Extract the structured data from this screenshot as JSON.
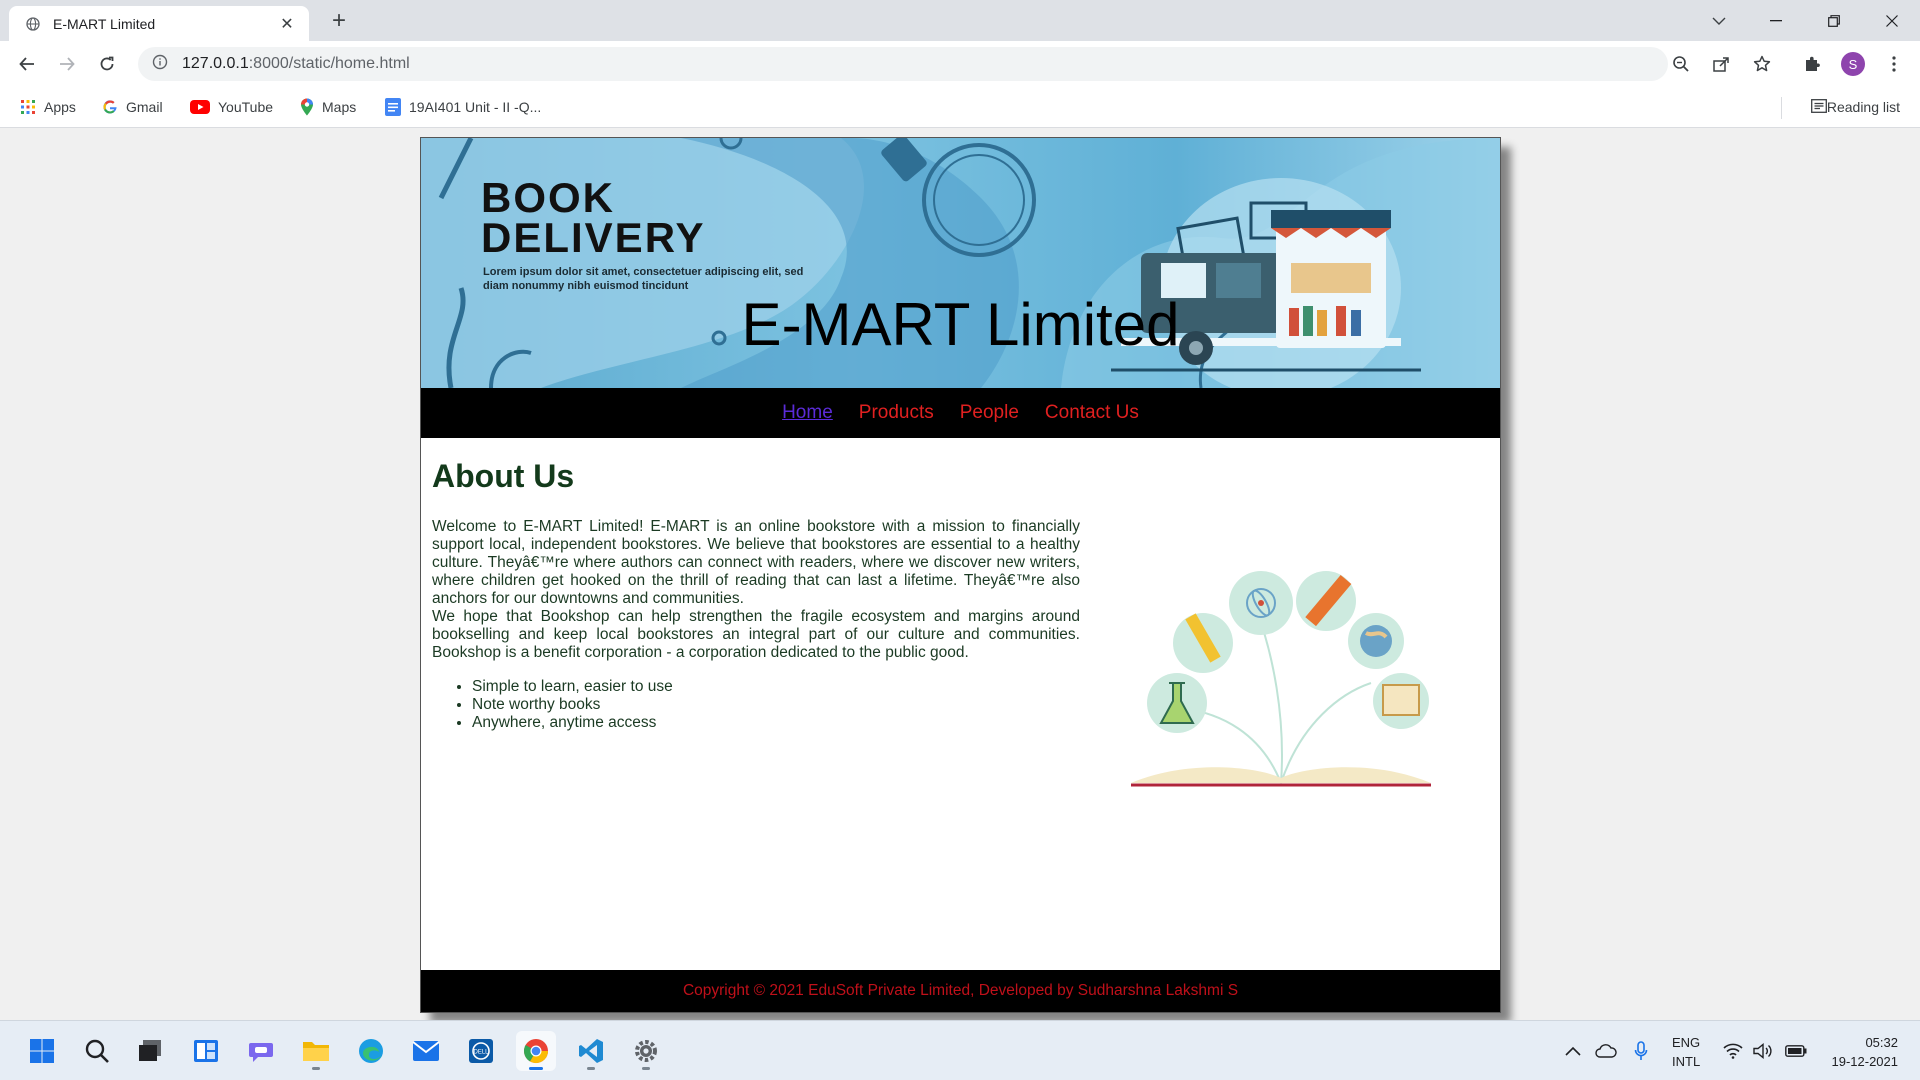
{
  "browser": {
    "tab_title": "E-MART Limited",
    "url_host": "127.0.0.1",
    "url_rest": ":8000/static/home.html",
    "profile_initial": "S"
  },
  "bookmarks": [
    {
      "label": "Apps",
      "icon": "apps-grid-icon"
    },
    {
      "label": "Gmail",
      "icon": "google-icon"
    },
    {
      "label": "YouTube",
      "icon": "youtube-icon"
    },
    {
      "label": "Maps",
      "icon": "maps-pin-icon"
    },
    {
      "label": "19AI401 Unit - II -Q...",
      "icon": "docs-icon"
    }
  ],
  "reading_list": "Reading list",
  "site": {
    "banner": {
      "heading_line1": "BOOK",
      "heading_line2": "DELIVERY",
      "lorem_line1": "Lorem ipsum dolor sit amet, consectetuer adipiscing elit, sed",
      "lorem_line2": "diam nonummy nibh euismod tincidunt"
    },
    "title": "E-MART Limited",
    "nav": [
      "Home",
      "Products",
      "People",
      "Contact Us"
    ],
    "about_heading": "About Us",
    "about_p1": "Welcome to E-MART Limited! E-MART is an online bookstore with a mission to financially support local, independent bookstores. We believe that bookstores are essential to a healthy culture. Theyâ€™re where authors can connect with readers, where we discover new writers, where children get hooked on the thrill of reading that can last a lifetime. Theyâ€™re also anchors for our downtowns and communities.",
    "about_p2": "We hope that Bookshop can help strengthen the fragile ecosystem and margins around bookselling and keep local bookstores an integral part of our culture and communities. Bookshop is a benefit corporation - a corporation dedicated to the public good.",
    "features": [
      "Simple to learn, easier to use",
      "Note worthy books",
      "Anywhere, anytime access"
    ],
    "footer": "Copyright © 2021 EduSoft Private Limited, Developed by Sudharshna Lakshmi S"
  },
  "taskbar": {
    "lang_line1": "ENG",
    "lang_line2": "INTL",
    "time": "05:32",
    "date": "19-12-2021"
  },
  "colors": {
    "nav_link": "#e02020",
    "nav_active": "#5b2bd8",
    "heading": "#133a1b",
    "footer_text": "#c0101a"
  }
}
